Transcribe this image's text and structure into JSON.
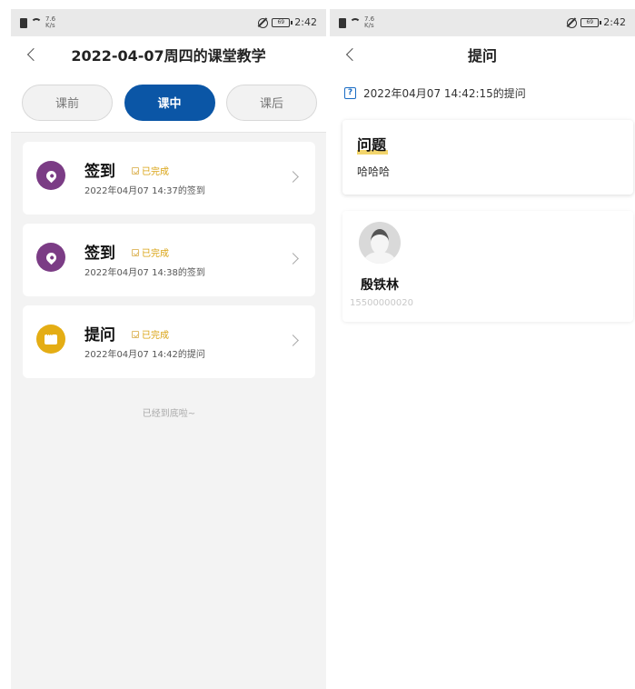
{
  "left": {
    "status_bar": {
      "speed_top": "7.6",
      "speed_bottom": "K/s",
      "time": "2:42",
      "battery": "69"
    },
    "nav": {
      "title": "2022-04-07周四的课堂教学"
    },
    "tabs": [
      {
        "label": "课前",
        "active": false
      },
      {
        "label": "课中",
        "active": true
      },
      {
        "label": "课后",
        "active": false
      }
    ],
    "activities": [
      {
        "title": "签到",
        "status": "已完成",
        "subtitle": "2022年04月07 14:37的签到",
        "icon": "location-pin-icon"
      },
      {
        "title": "签到",
        "status": "已完成",
        "subtitle": "2022年04月07 14:38的签到",
        "icon": "location-pin-icon"
      },
      {
        "title": "提问",
        "status": "已完成",
        "subtitle": "2022年04月07 14:42的提问",
        "icon": "chat-bubble-icon"
      }
    ],
    "end_text": "已经到底啦~"
  },
  "right": {
    "status_bar": {
      "speed_top": "7.6",
      "speed_bottom": "K/s",
      "time": "2:42",
      "battery": "69"
    },
    "nav": {
      "title": "提问"
    },
    "question_meta": "2022年04月07 14:42:15的提问",
    "question": {
      "heading": "问题",
      "text": "哈哈哈"
    },
    "responder": {
      "name": "殷铁林",
      "phone": "15500000020"
    }
  },
  "colors": {
    "accent": "#0b56a6",
    "purple_icon": "#7b3c85",
    "yellow_icon": "#e4ad14",
    "status_text": "#d9a312"
  }
}
